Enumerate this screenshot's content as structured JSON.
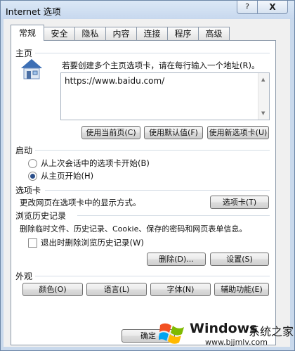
{
  "window": {
    "title": "Internet 选项",
    "help_label": "?",
    "close_label": "X"
  },
  "tabs": [
    {
      "label": "常规",
      "active": true
    },
    {
      "label": "安全"
    },
    {
      "label": "隐私"
    },
    {
      "label": "内容"
    },
    {
      "label": "连接"
    },
    {
      "label": "程序"
    },
    {
      "label": "高级"
    }
  ],
  "home": {
    "title": "主页",
    "description": "若要创建多个主页选项卡，请在每行输入一个地址(R)。",
    "url": "https://www.baidu.com/",
    "use_current": "使用当前页(C)",
    "use_default": "使用默认值(F)",
    "use_new_tab": "使用新选项卡(U)"
  },
  "startup": {
    "title": "启动",
    "option_last_session": "从上次会话中的选项卡开始(B)",
    "option_home": "从主页开始(H)",
    "selected": "home"
  },
  "tabs_section": {
    "title": "选项卡",
    "description": "更改网页在选项卡中的显示方式。",
    "button": "选项卡(T)"
  },
  "history": {
    "title": "浏览历史记录",
    "description": "删除临时文件、历史记录、Cookie、保存的密码和网页表单信息。",
    "checkbox": "退出时删除浏览历史记录(W)",
    "checked": false,
    "delete_button": "删除(D)...",
    "settings_button": "设置(S)"
  },
  "appearance": {
    "title": "外观",
    "colors": "颜色(O)",
    "languages": "语言(L)",
    "fonts": "字体(N)",
    "accessibility": "辅助功能(E)"
  },
  "footer": {
    "ok": "确定"
  },
  "watermark": {
    "brand": "Windows",
    "site_name": "系统之家",
    "url": "www.bjjmlv.com"
  }
}
